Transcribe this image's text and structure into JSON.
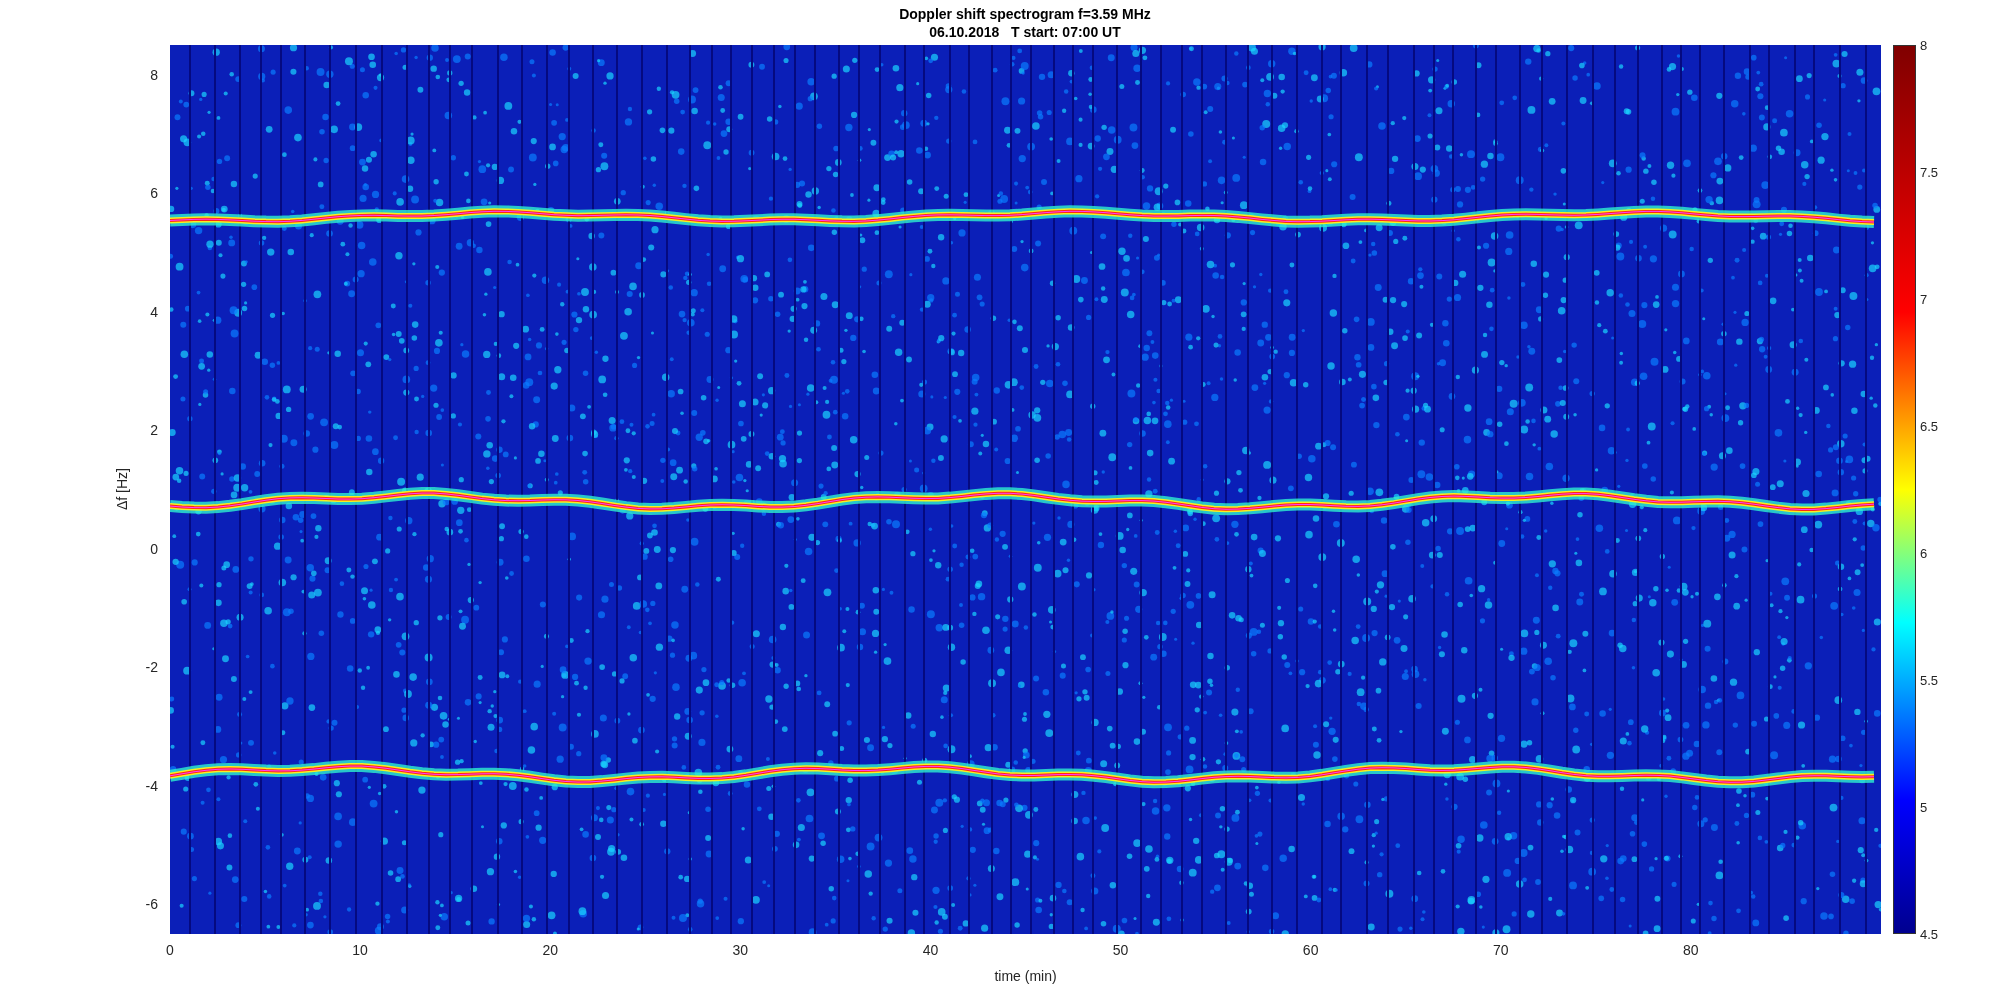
{
  "figure": {
    "title": "Doppler shift spectrogram f=3.59 MHz",
    "subtitle": "06.10.2018   T start: 07:00 UT"
  },
  "axes": {
    "ylabel": "Δf [Hz]",
    "xlabel": "time (min)",
    "y_ticks": [
      "8",
      "6",
      "4",
      "2",
      "0",
      "-2",
      "-4",
      "-6"
    ],
    "x_ticks": [
      "0",
      "10",
      "20",
      "30",
      "40",
      "50",
      "60",
      "70",
      "80"
    ]
  },
  "colorbar": {
    "ticks": [
      "8",
      "7.5",
      "7",
      "6.5",
      "6",
      "5.5",
      "5",
      "4.5"
    ]
  }
}
